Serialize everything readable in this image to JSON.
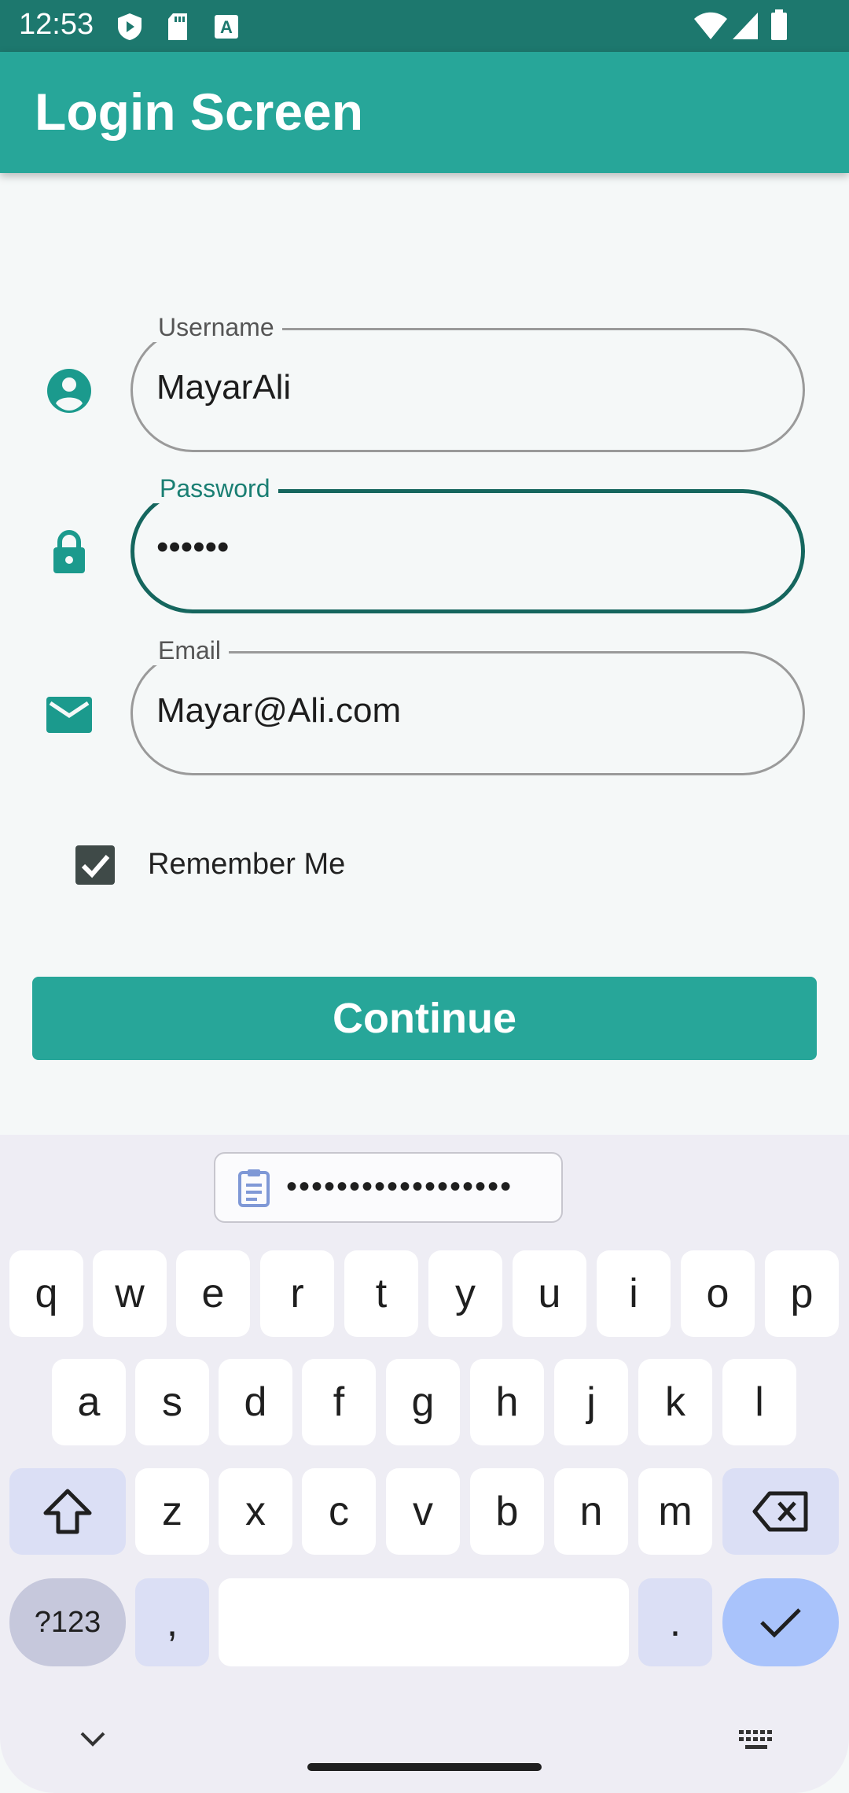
{
  "status_bar": {
    "time": "12:53"
  },
  "app_bar": {
    "title": "Login Screen"
  },
  "form": {
    "username": {
      "label": "Username",
      "value": "MayarAli"
    },
    "password": {
      "label": "Password",
      "value": "••••••"
    },
    "email": {
      "label": "Email",
      "value": "Mayar@Ali.com"
    },
    "remember": {
      "label": "Remember Me",
      "checked": true
    },
    "continue_label": "Continue"
  },
  "keyboard": {
    "clipboard_suggestion": "••••••••••••••••••",
    "row1": [
      "q",
      "w",
      "e",
      "r",
      "t",
      "y",
      "u",
      "i",
      "o",
      "p"
    ],
    "row2": [
      "a",
      "s",
      "d",
      "f",
      "g",
      "h",
      "j",
      "k",
      "l"
    ],
    "row3": [
      "z",
      "x",
      "c",
      "v",
      "b",
      "n",
      "m"
    ],
    "symbols_label": "?123",
    "comma_label": ",",
    "period_label": "."
  },
  "colors": {
    "primary": "#27a699",
    "status_bar": "#1d786e",
    "focused_outline": "#15665e"
  }
}
